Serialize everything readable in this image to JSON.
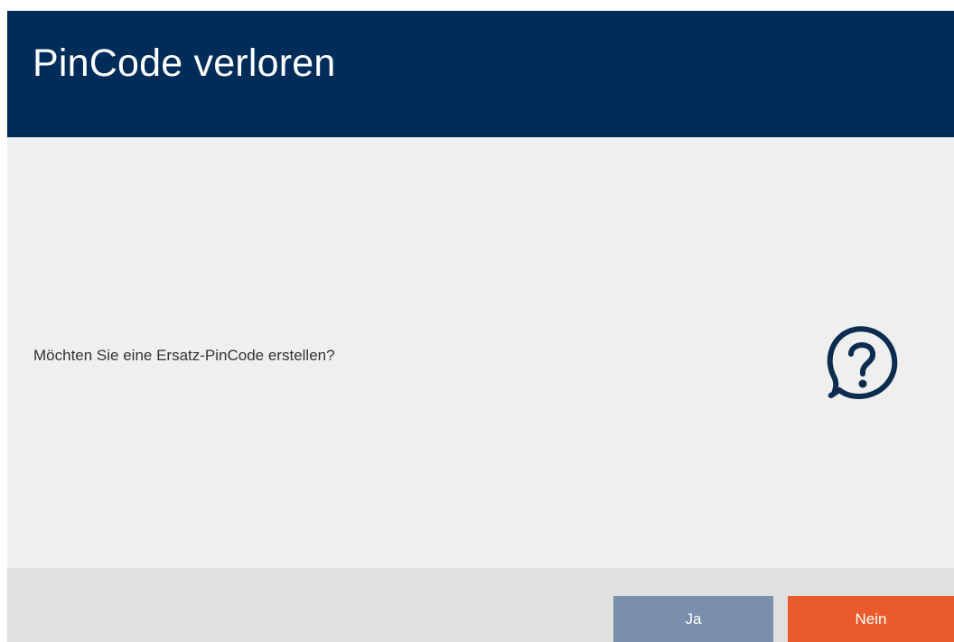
{
  "dialog": {
    "title": "PinCode verloren",
    "message": "Möchten Sie eine Ersatz-PinCode erstellen?",
    "icon": "question-speech-bubble-icon"
  },
  "buttons": {
    "yes_label": "Ja",
    "no_label": "Nein"
  },
  "colors": {
    "header_bg": "#002c59",
    "content_bg": "#efefef",
    "footer_bg": "#e0e0e0",
    "icon_color": "#0b2c4f",
    "yes_button": "#7a8fab",
    "no_button": "#ea5b2c"
  }
}
